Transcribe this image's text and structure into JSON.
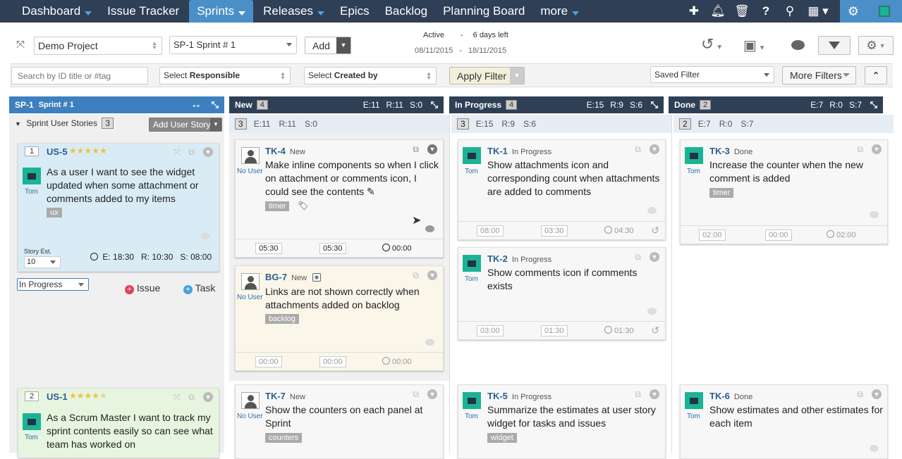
{
  "nav": {
    "items": [
      {
        "label": "Dashboard",
        "caret": true
      },
      {
        "label": "Issue Tracker",
        "caret": false
      },
      {
        "label": "Sprints",
        "caret": true,
        "active": true
      },
      {
        "label": "Releases",
        "caret": true
      },
      {
        "label": "Epics",
        "caret": false
      },
      {
        "label": "Backlog",
        "caret": false
      },
      {
        "label": "Planning Board",
        "caret": false
      },
      {
        "label": "more",
        "caret": true
      }
    ]
  },
  "toolbar": {
    "project": "Demo Project",
    "sprint": "SP-1 Sprint # 1",
    "add_label": "Add",
    "status": "Active",
    "dash": "-",
    "days_left": "6 days left",
    "start": "08/11/2015",
    "end": "18/11/2015"
  },
  "filters": {
    "search_placeholder": "Search by ID title or #tag",
    "responsible_prefix": "Select ",
    "responsible_bold": "Responsible",
    "created_prefix": "Select ",
    "created_bold": "Created by",
    "apply": "Apply Filter",
    "saved": "Saved Filter",
    "more": "More Filters"
  },
  "sprint_col": {
    "title": "SP-1",
    "subtitle": "Sprint # 1",
    "stories_label": "Sprint User Stories",
    "stories_count": "3",
    "add_story": "Add User Story"
  },
  "stories": [
    {
      "rank": "1",
      "id": "US-5",
      "stars": 5,
      "title": "As a user I want to see the widget updated when some attachment or comments added to my items",
      "tag": "ux",
      "user": "Tom",
      "est_label": "Story Est.",
      "est_value": "10",
      "e": "E: 18:30",
      "r": "R: 10:30",
      "s": "S: 08:00",
      "status": "In Progress",
      "issue": "Issue",
      "task": "Task"
    },
    {
      "rank": "2",
      "id": "US-1",
      "stars": 5,
      "title": "As a Scrum Master I want to track my sprint contents easily so can see what team has worked on",
      "user": "Tom"
    }
  ],
  "columns": [
    {
      "title": "New",
      "count": "4",
      "e": "E:11",
      "r": "R:11",
      "s": "S:0",
      "sub_count": "3",
      "sub_e": "E:11",
      "sub_r": "R:11",
      "sub_s": "S:0"
    },
    {
      "title": "In Progress",
      "count": "4",
      "e": "E:15",
      "r": "R:9",
      "s": "S:6",
      "sub_count": "3",
      "sub_e": "E:15",
      "sub_r": "R:9",
      "sub_s": "S:6"
    },
    {
      "title": "Done",
      "count": "2",
      "e": "E:7",
      "r": "R:0",
      "s": "S:7",
      "sub_count": "2",
      "sub_e": "E:7",
      "sub_r": "R:0",
      "sub_s": "S:7"
    }
  ],
  "cards": {
    "tk4": {
      "id": "TK-4",
      "status": "New",
      "title": "Make inline components so when I click on attachment or comments icon, I could see the contents",
      "tag": "timer",
      "user": "No User",
      "t1": "05:30",
      "t2": "05:30",
      "t3": "00:00"
    },
    "bg7": {
      "id": "BG-7",
      "status": "New",
      "title": "Links are not shown correctly when attachments added on backlog",
      "tag": "backlog",
      "user": "No User",
      "t1": "00:00",
      "t2": "00:00",
      "t3": "00:00"
    },
    "tk7": {
      "id": "TK-7",
      "status": "New",
      "title": "Show the counters on each panel at Sprint",
      "tag": "counters",
      "user": "No User"
    },
    "tk1": {
      "id": "TK-1",
      "status": "In Progress",
      "title": "Show attachments icon and corresponding count when attachments are added to comments",
      "user": "Tom",
      "t1": "08:00",
      "t2": "03:30",
      "t3": "04:30"
    },
    "tk2": {
      "id": "TK-2",
      "status": "In Progress",
      "title": "Show comments icon if comments exists",
      "user": "Tom",
      "t1": "03:00",
      "t2": "01:30",
      "t3": "01:30"
    },
    "tk5": {
      "id": "TK-5",
      "status": "In Progress",
      "title": "Summarize the estimates at user story widget for tasks and issues",
      "tag": "widget",
      "user": "Tom"
    },
    "tk3": {
      "id": "TK-3",
      "status": "Done",
      "title": "Increase the counter when the new comment is added",
      "tag": "timer",
      "user": "Tom",
      "t1": "02:00",
      "t2": "00:00",
      "t3": "02:00"
    },
    "tk6": {
      "id": "TK-6",
      "status": "Done",
      "title": "Show estimates and other estimates for each item",
      "user": "Tom"
    }
  }
}
